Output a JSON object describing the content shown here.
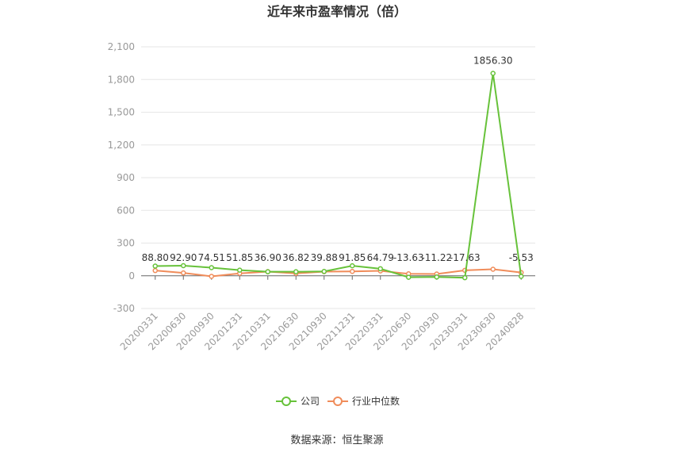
{
  "chart_data": {
    "type": "line",
    "title": "近年来市盈率情况（倍）",
    "categories": [
      "20200331",
      "20200630",
      "20200930",
      "20201231",
      "20210331",
      "20210630",
      "20210930",
      "20211231",
      "20220331",
      "20220630",
      "20220930",
      "20230331",
      "20230630",
      "20240828"
    ],
    "series": [
      {
        "name": "公司",
        "color": "#67c23a",
        "values": [
          88.8,
          92.9,
          74.51,
          51.85,
          36.9,
          36.82,
          39.88,
          91.85,
          64.79,
          -13.63,
          -11.22,
          -17.63,
          1856.3,
          -5.53
        ],
        "labels": [
          "88.80",
          "92.90",
          "74.51",
          "51.85",
          "36.90",
          "36.82",
          "39.88",
          "91.85",
          "64.79",
          "-13.63",
          "-11.22",
          "-17.63",
          "1856.30",
          "-5.53"
        ]
      },
      {
        "name": "行业中位数",
        "color": "#f08c5a",
        "values": [
          48,
          26,
          -5,
          22,
          38,
          22,
          38,
          40,
          45,
          18,
          16,
          50,
          60,
          30
        ]
      }
    ],
    "yticks": [
      "2,100",
      "1,800",
      "1,500",
      "1,200",
      "900",
      "600",
      "300",
      "0",
      "-300"
    ],
    "ylim": [
      -300,
      2100
    ],
    "grid": true,
    "legend_position": "bottom"
  },
  "source_text": "数据来源：恒生聚源"
}
